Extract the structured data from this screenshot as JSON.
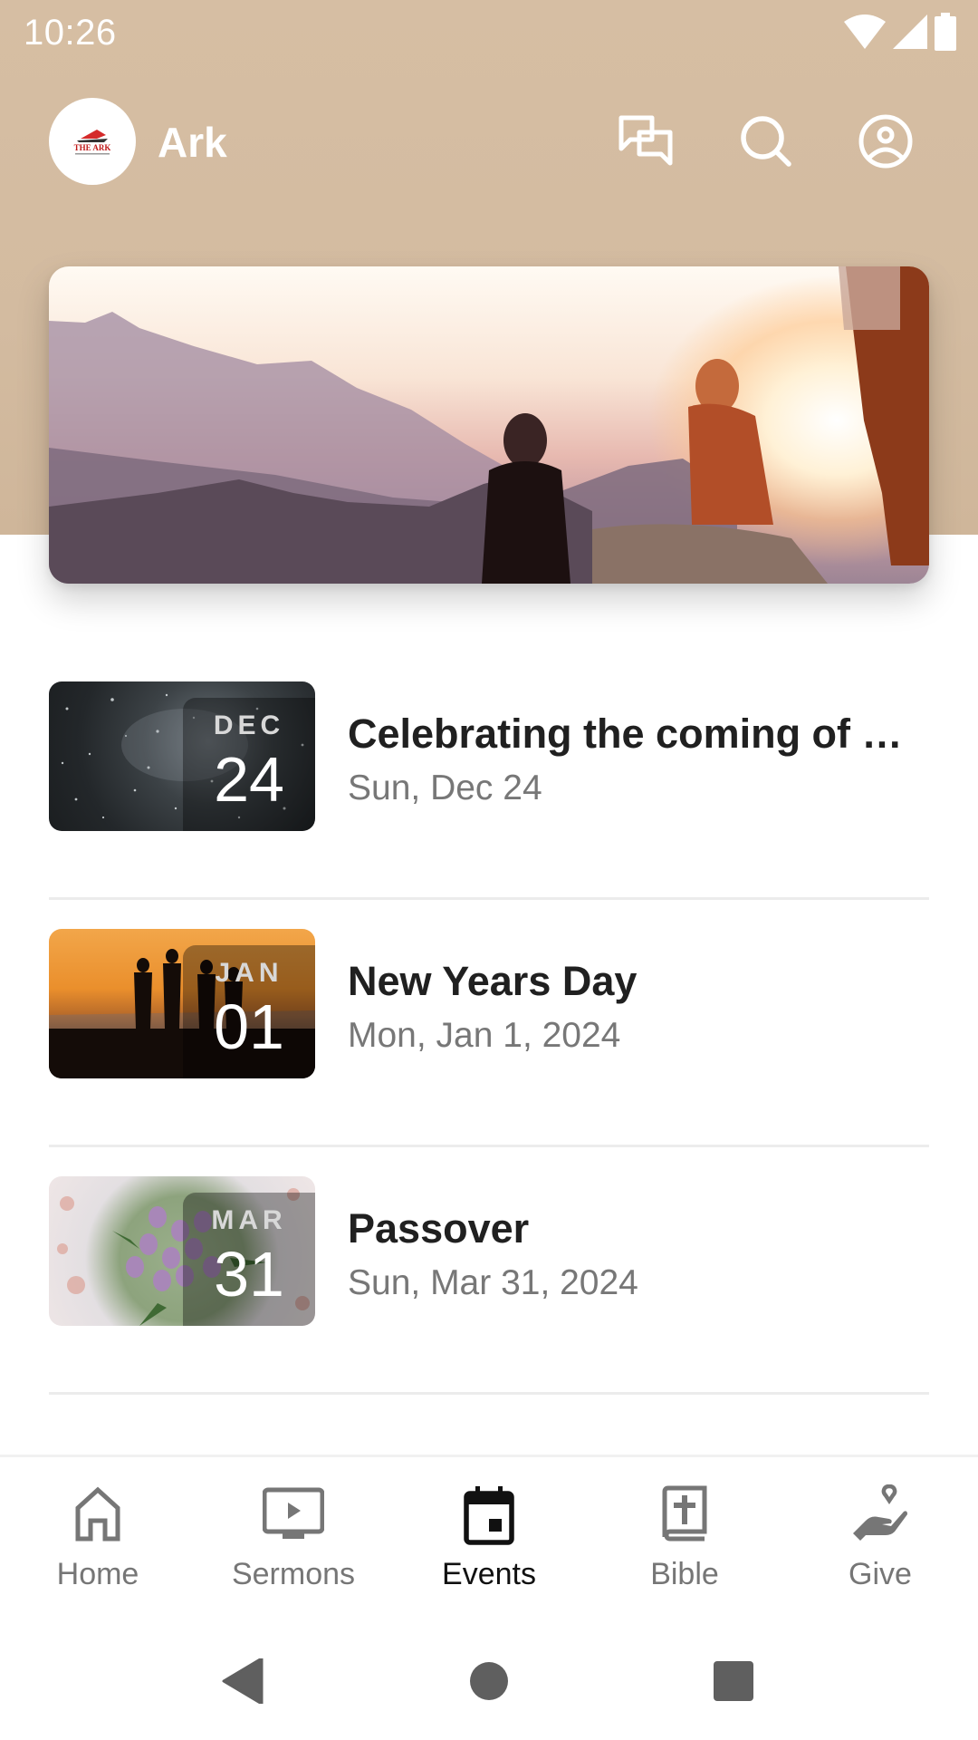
{
  "status_bar": {
    "time": "10:26",
    "icons": [
      "wifi-icon",
      "cellular-signal-icon",
      "battery-icon"
    ]
  },
  "app_bar": {
    "logo_text": "THE ARK",
    "title": "Ark",
    "actions": [
      {
        "name": "messages",
        "icon": "chat-bubbles-icon"
      },
      {
        "name": "search",
        "icon": "search-icon"
      },
      {
        "name": "profile",
        "icon": "account-circle-icon"
      }
    ]
  },
  "hero": {
    "image_description": "people watching a sunset over mountains"
  },
  "events": [
    {
      "month": "DEC",
      "day": "24",
      "title": "Celebrating the coming of E…",
      "date": "Sun, Dec 24",
      "image": "starry-night"
    },
    {
      "month": "JAN",
      "day": "01",
      "title": "New Years Day",
      "date": "Mon, Jan 1, 2024",
      "image": "sunset-silhouettes"
    },
    {
      "month": "MAR",
      "day": "31",
      "title": "Passover",
      "date": "Sun, Mar 31, 2024",
      "image": "purple-tulips"
    }
  ],
  "bottom_nav": {
    "active": "Events",
    "items": [
      {
        "label": "Home",
        "icon": "home-icon"
      },
      {
        "label": "Sermons",
        "icon": "tv-play-icon"
      },
      {
        "label": "Events",
        "icon": "calendar-icon"
      },
      {
        "label": "Bible",
        "icon": "bible-icon"
      },
      {
        "label": "Give",
        "icon": "give-hand-heart-icon"
      }
    ]
  },
  "system_nav": [
    "back",
    "home",
    "recents"
  ],
  "colors": {
    "header_bg": "#d4bca1",
    "active_nav": "#111111",
    "inactive_nav": "#767676",
    "title_text": "#202020",
    "subtitle_text": "#777777"
  }
}
